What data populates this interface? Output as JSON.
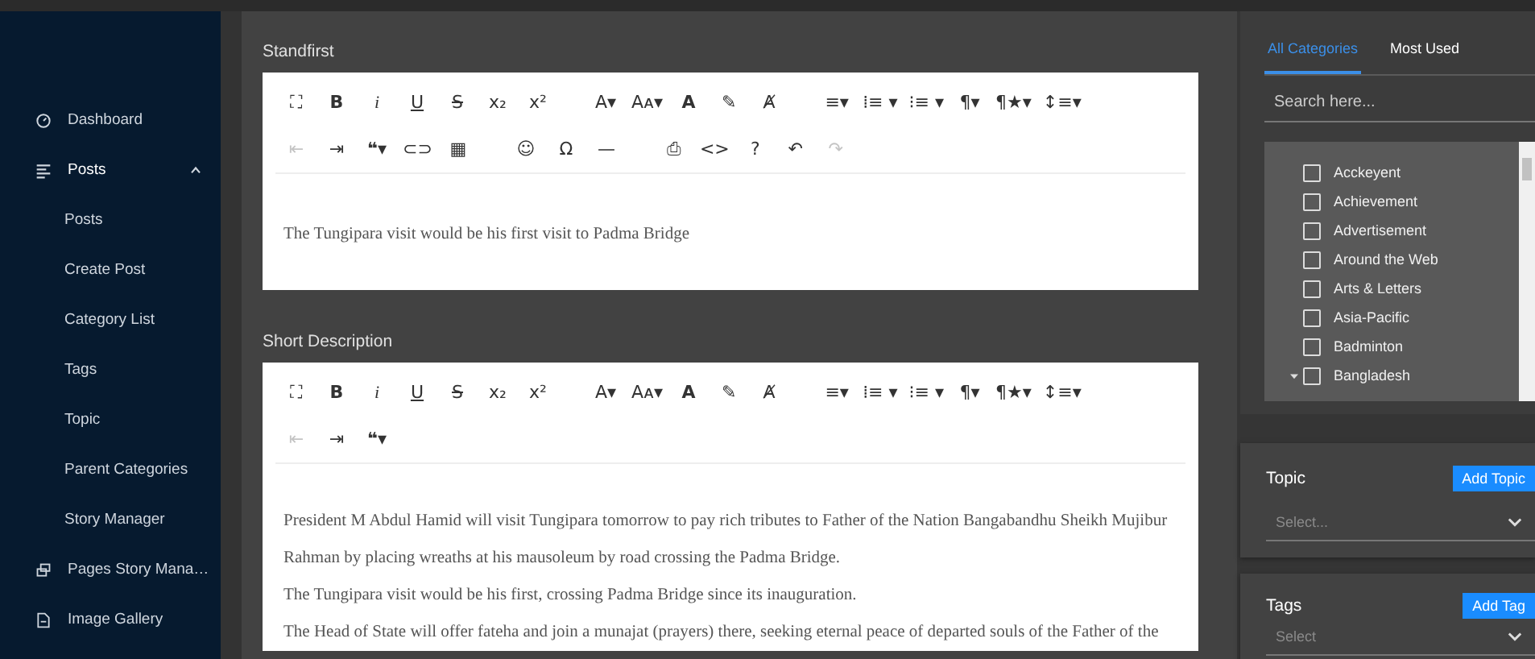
{
  "sidebar": {
    "items": [
      {
        "label": "Dashboard",
        "kind": "gauge"
      },
      {
        "label": "Posts",
        "kind": "lines",
        "expanded": true,
        "children": [
          {
            "label": "Posts"
          },
          {
            "label": "Create Post"
          },
          {
            "label": "Category List"
          },
          {
            "label": "Tags"
          },
          {
            "label": "Topic"
          },
          {
            "label": "Parent Categories"
          },
          {
            "label": "Story Manager"
          }
        ]
      },
      {
        "label": "Pages Story Mana…",
        "kind": "pages"
      },
      {
        "label": "Image Gallery",
        "kind": "file"
      }
    ]
  },
  "editors": [
    {
      "label": "Standfirst",
      "toolbar": [
        [
          [
            {
              "glyph": "⛶",
              "kind": "plain",
              "disabled": false
            },
            {
              "glyph": "B",
              "kind": "bold",
              "disabled": false
            },
            {
              "glyph": "i",
              "kind": "italic",
              "disabled": false
            },
            {
              "glyph": "U",
              "kind": "underline",
              "disabled": false
            },
            {
              "glyph": "S",
              "kind": "strike",
              "disabled": false
            },
            {
              "glyph": "x₂",
              "kind": "plain",
              "disabled": false
            },
            {
              "glyph": "x²",
              "kind": "plain",
              "disabled": false
            }
          ],
          [
            {
              "glyph": "A▾",
              "kind": "plain",
              "disabled": false
            },
            {
              "glyph": "Aᴀ▾",
              "kind": "plain",
              "disabled": false
            },
            {
              "glyph": "A",
              "kind": "bold",
              "disabled": false
            },
            {
              "glyph": "✎",
              "kind": "plain",
              "disabled": false
            },
            {
              "glyph": "Ⱥ",
              "kind": "plain",
              "disabled": false
            }
          ],
          [
            {
              "glyph": "≡▾",
              "kind": "plain",
              "disabled": false
            },
            {
              "glyph": "⁞≡ ▾",
              "kind": "plain",
              "disabled": false
            },
            {
              "glyph": "⁝≡ ▾",
              "kind": "plain",
              "disabled": false
            },
            {
              "glyph": "¶▾",
              "kind": "plain",
              "disabled": false
            },
            {
              "glyph": "¶★▾",
              "kind": "plain",
              "disabled": false
            },
            {
              "glyph": "↕≡▾",
              "kind": "plain",
              "disabled": false
            }
          ]
        ],
        [
          [
            {
              "glyph": "⇤",
              "kind": "plain",
              "disabled": true
            },
            {
              "glyph": "⇥",
              "kind": "plain",
              "disabled": false
            },
            {
              "glyph": "❝▾",
              "kind": "bold",
              "disabled": false
            },
            {
              "glyph": "⊂⊃",
              "kind": "plain",
              "disabled": false
            },
            {
              "glyph": "▦",
              "kind": "plain",
              "disabled": false
            }
          ],
          [
            {
              "glyph": "☺",
              "kind": "plain",
              "disabled": false
            },
            {
              "glyph": "Ω",
              "kind": "plain",
              "disabled": false
            },
            {
              "glyph": "—",
              "kind": "plain",
              "disabled": false
            }
          ],
          [
            {
              "glyph": "⎙",
              "kind": "plain",
              "disabled": false
            },
            {
              "glyph": "<>",
              "kind": "plain",
              "disabled": false
            },
            {
              "glyph": "?",
              "kind": "plain",
              "disabled": false
            },
            {
              "glyph": "↶",
              "kind": "plain",
              "disabled": false
            },
            {
              "glyph": "↷",
              "kind": "plain",
              "disabled": true
            }
          ]
        ]
      ],
      "paragraphs": [
        "The Tungipara visit would be his first visit to Padma Bridge"
      ]
    },
    {
      "label": "Short Description",
      "toolbar": [
        [
          [
            {
              "glyph": "⛶",
              "kind": "plain",
              "disabled": false
            },
            {
              "glyph": "B",
              "kind": "bold",
              "disabled": false
            },
            {
              "glyph": "i",
              "kind": "italic",
              "disabled": false
            },
            {
              "glyph": "U",
              "kind": "underline",
              "disabled": false
            },
            {
              "glyph": "S",
              "kind": "strike",
              "disabled": false
            },
            {
              "glyph": "x₂",
              "kind": "plain",
              "disabled": false
            },
            {
              "glyph": "x²",
              "kind": "plain",
              "disabled": false
            }
          ],
          [
            {
              "glyph": "A▾",
              "kind": "plain",
              "disabled": false
            },
            {
              "glyph": "Aᴀ▾",
              "kind": "plain",
              "disabled": false
            },
            {
              "glyph": "A",
              "kind": "bold",
              "disabled": false
            },
            {
              "glyph": "✎",
              "kind": "plain",
              "disabled": false
            },
            {
              "glyph": "Ⱥ",
              "kind": "plain",
              "disabled": false
            }
          ],
          [
            {
              "glyph": "≡▾",
              "kind": "plain",
              "disabled": false
            },
            {
              "glyph": "⁞≡ ▾",
              "kind": "plain",
              "disabled": false
            },
            {
              "glyph": "⁝≡ ▾",
              "kind": "plain",
              "disabled": false
            },
            {
              "glyph": "¶▾",
              "kind": "plain",
              "disabled": false
            },
            {
              "glyph": "¶★▾",
              "kind": "plain",
              "disabled": false
            },
            {
              "glyph": "↕≡▾",
              "kind": "plain",
              "disabled": false
            }
          ]
        ],
        [
          [
            {
              "glyph": "⇤",
              "kind": "plain",
              "disabled": true
            },
            {
              "glyph": "⇥",
              "kind": "plain",
              "disabled": false
            },
            {
              "glyph": "❝▾",
              "kind": "bold",
              "disabled": false
            }
          ]
        ]
      ],
      "paragraphs": [
        "President M Abdul Hamid will visit Tungipara tomorrow to pay rich tributes to Father of the Nation Bangabandhu Sheikh Mujibur Rahman by placing wreaths at his mausoleum by road crossing the Padma Bridge.",
        "The Tungipara visit would be his first, crossing Padma Bridge since its inauguration.",
        "The Head of State will offer fateha and join a munajat (prayers) there, seeking eternal peace of departed souls of the Father of the"
      ]
    }
  ],
  "categories": {
    "tabs": [
      {
        "label": "All Categories",
        "selected": true
      },
      {
        "label": "Most Used",
        "selected": false
      }
    ],
    "search": {
      "placeholder": "Search here..."
    },
    "items": [
      {
        "label": "Acckeyent",
        "checked": false
      },
      {
        "label": "Achievement",
        "checked": false
      },
      {
        "label": "Advertisement",
        "checked": false
      },
      {
        "label": "Around the Web",
        "checked": false
      },
      {
        "label": "Arts & Letters",
        "checked": false
      },
      {
        "label": "Asia-Pacific",
        "checked": false
      },
      {
        "label": "Badminton",
        "checked": false
      },
      {
        "label": "Bangladesh",
        "checked": false,
        "expanded": true
      }
    ]
  },
  "panels": [
    {
      "title": "Topic",
      "button": "Add Topic",
      "placeholder": "Select..."
    },
    {
      "title": "Tags",
      "button": "Add Tag",
      "placeholder": "Select"
    }
  ]
}
